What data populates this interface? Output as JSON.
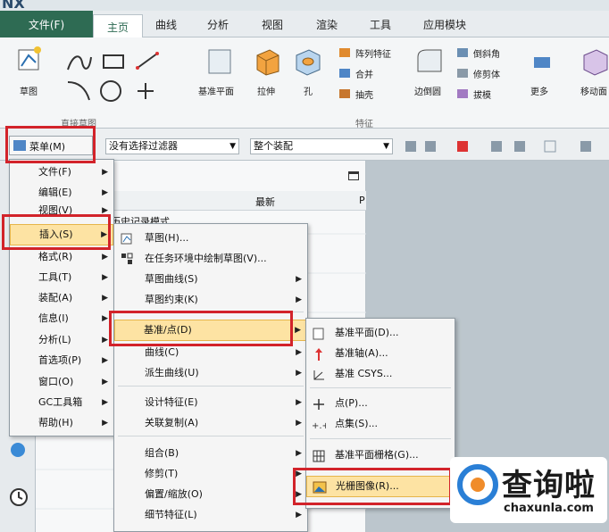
{
  "app": {
    "logo_text": "NX"
  },
  "tabs": {
    "file": "文件(F)",
    "items": [
      "主页",
      "曲线",
      "分析",
      "视图",
      "渲染",
      "工具",
      "应用模块"
    ]
  },
  "ribbon": {
    "sketch": "草图",
    "direct_sketch_group": "直接草图",
    "datum_plane": "基准平面",
    "extrude": "拉伸",
    "hole": "孔",
    "pattern_feature": "阵列特征",
    "unite": "合并",
    "shell": "抽壳",
    "edge_blend": "边倒圆",
    "chamfer": "倒斜角",
    "trim_body": "修剪体",
    "draft": "拔模",
    "more": "更多",
    "move_face": "移动面",
    "feature_group": "特征"
  },
  "selbar": {
    "menu_button": "菜单(M)",
    "filter": "没有选择过滤器",
    "scope": "整个装配"
  },
  "nav": {
    "col_latest": "最新",
    "col_p": "P",
    "row_history": "历史记录模式"
  },
  "main_menu": [
    {
      "label": "文件(F)",
      "sub": true
    },
    {
      "label": "编辑(E)",
      "sub": true
    },
    {
      "label": "视图(V)",
      "sub": true
    },
    {
      "label": "插入(S)",
      "sub": true
    },
    {
      "label": "格式(R)",
      "sub": true
    },
    {
      "label": "工具(T)",
      "sub": true
    },
    {
      "label": "装配(A)",
      "sub": true
    },
    {
      "label": "信息(I)",
      "sub": true
    },
    {
      "label": "分析(L)",
      "sub": true
    },
    {
      "label": "首选项(P)",
      "sub": true
    },
    {
      "label": "窗口(O)",
      "sub": true
    },
    {
      "label": "GC工具箱",
      "sub": true
    },
    {
      "label": "帮助(H)",
      "sub": true
    }
  ],
  "insert_menu": [
    {
      "label": "草图(H)...",
      "icon": "sketch-icon"
    },
    {
      "label": "在任务环境中绘制草图(V)...",
      "icon": "task-sketch-icon"
    },
    {
      "label": "草图曲线(S)",
      "sub": true
    },
    {
      "label": "草图约束(K)",
      "sub": true
    },
    {
      "label": "基准/点(D)",
      "sub": true
    },
    {
      "label": "曲线(C)",
      "sub": true
    },
    {
      "label": "派生曲线(U)",
      "sub": true
    },
    {
      "label": "设计特征(E)",
      "sub": true
    },
    {
      "label": "关联复制(A)",
      "sub": true
    },
    {
      "label": "组合(B)",
      "sub": true
    },
    {
      "label": "修剪(T)",
      "sub": true
    },
    {
      "label": "偏置/缩放(O)",
      "sub": true
    },
    {
      "label": "细节特征(L)",
      "sub": true
    }
  ],
  "datum_menu": [
    {
      "label": "基准平面(D)...",
      "icon": "datum-plane-icon"
    },
    {
      "label": "基准轴(A)...",
      "icon": "datum-axis-icon"
    },
    {
      "label": "基准 CSYS...",
      "icon": "datum-csys-icon"
    },
    {
      "label": "点(P)...",
      "icon": "point-icon"
    },
    {
      "label": "点集(S)...",
      "icon": "point-set-icon"
    },
    {
      "label": "基准平面栅格(G)...",
      "icon": "datum-grid-icon"
    },
    {
      "label": "光栅图像(R)...",
      "icon": "raster-image-icon"
    }
  ],
  "watermark": {
    "text": "查询啦",
    "url": "chaxunla.com"
  },
  "colors": {
    "accent": "#2e6b53",
    "highlight": "#fde3a3",
    "annotation": "#d2232a"
  }
}
